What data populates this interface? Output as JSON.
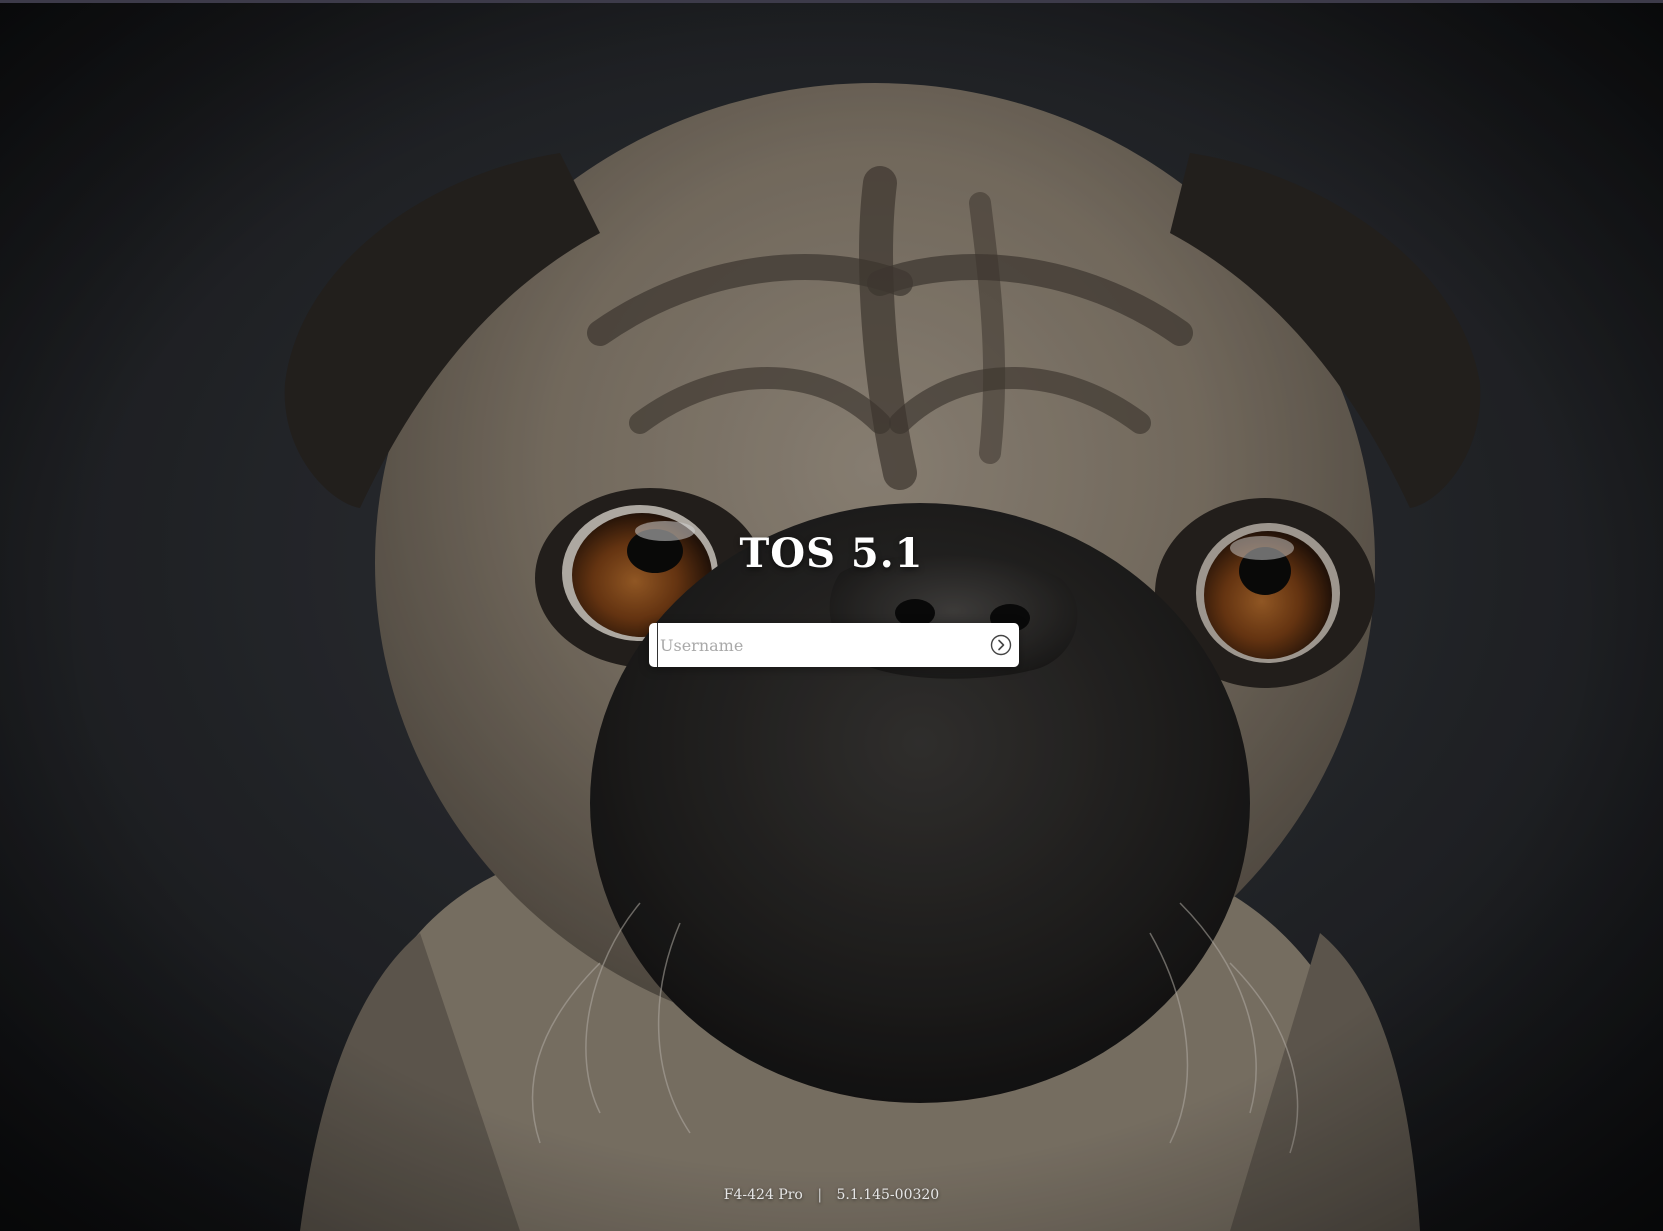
{
  "login": {
    "title": "TOS 5.1",
    "username_placeholder": "Username",
    "username_value": ""
  },
  "footer": {
    "model": "F4-424 Pro",
    "separator": "|",
    "version": "5.1.145-00320"
  },
  "icons": {
    "submit": "arrow-right-circle-icon"
  },
  "colors": {
    "title_text": "#ffffff",
    "input_bg": "#ffffff",
    "placeholder": "#a9a9a9",
    "footer_text": "#e6e6e6",
    "background_dark": "#1a1b1e"
  }
}
